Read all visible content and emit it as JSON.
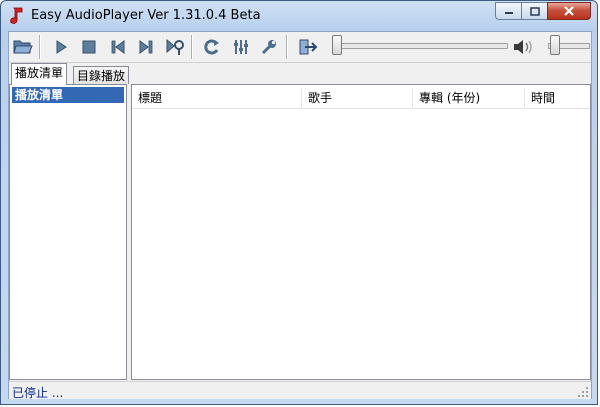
{
  "window": {
    "title": "Easy AudioPlayer Ver 1.31.0.4 Beta"
  },
  "toolbar": {
    "buttons": [
      "open-folder",
      "play",
      "stop",
      "previous",
      "next",
      "play-options",
      "refresh",
      "equalizer",
      "settings",
      "exit"
    ],
    "position": 0.0,
    "volume": 0.1
  },
  "tabs": [
    {
      "label": "播放清單",
      "active": true
    },
    {
      "label": "目錄播放",
      "active": false
    }
  ],
  "playlist": {
    "items": [
      "播放清單"
    ],
    "selected_index": 0
  },
  "columns": [
    "標題",
    "歌手",
    "專輯 (年份)",
    "時間"
  ],
  "rows": [],
  "status": {
    "text": "已停止 ..."
  },
  "colors": {
    "selection": "#3368b5",
    "status_text": "#0a2a8a",
    "close_button": "#c7503a"
  }
}
